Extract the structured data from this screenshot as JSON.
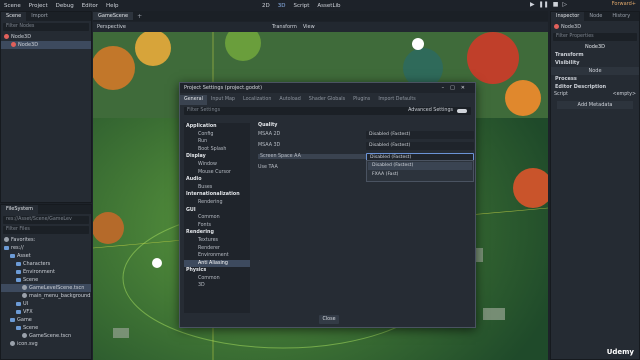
{
  "menu": [
    "Scene",
    "Project",
    "Debug",
    "Editor",
    "Help"
  ],
  "workspaces": [
    {
      "label": "2D"
    },
    {
      "label": "3D"
    },
    {
      "label": "Script"
    },
    {
      "label": "AssetLib"
    }
  ],
  "renderer": "Forward+",
  "scene_panel": {
    "tabs": [
      "Scene",
      "Import"
    ],
    "filter_placeholder": "Filter Nodes",
    "nodes": [
      "Node3D",
      "Node3D"
    ]
  },
  "scene_tabs": [
    "GameScene"
  ],
  "viewport": {
    "label": "Perspective",
    "menus": [
      "Transform",
      "View"
    ]
  },
  "filesystem": {
    "tab": "FileSystem",
    "path": "res://Asset/Scene/GameLev",
    "filter_placeholder": "Filter Files",
    "items": [
      {
        "label": "Favorites:",
        "indent": 0,
        "folder": false
      },
      {
        "label": "res://",
        "indent": 0,
        "folder": true
      },
      {
        "label": "Asset",
        "indent": 1,
        "folder": true
      },
      {
        "label": "Characters",
        "indent": 2,
        "folder": true
      },
      {
        "label": "Environment",
        "indent": 2,
        "folder": true
      },
      {
        "label": "Scene",
        "indent": 2,
        "folder": true
      },
      {
        "label": "GameLevelScene.tscn",
        "indent": 3,
        "folder": false,
        "selected": true
      },
      {
        "label": "main_menu_background.tscn",
        "indent": 3,
        "folder": false
      },
      {
        "label": "UI",
        "indent": 2,
        "folder": true
      },
      {
        "label": "VFX",
        "indent": 2,
        "folder": true
      },
      {
        "label": "Game",
        "indent": 1,
        "folder": true
      },
      {
        "label": "Scene",
        "indent": 2,
        "folder": true
      },
      {
        "label": "GameScene.tscn",
        "indent": 3,
        "folder": false
      },
      {
        "label": "icon.svg",
        "indent": 1,
        "folder": false
      }
    ]
  },
  "inspector": {
    "tabs": [
      "Inspector",
      "Node",
      "History"
    ],
    "node_name": "Node3D",
    "filter_placeholder": "Filter Properties",
    "sections": [
      "Transform",
      "Visibility"
    ],
    "class_label": "Node",
    "sections2": [
      "Process",
      "Editor Description"
    ],
    "script_label": "Script",
    "script_value": "<empty>",
    "add_metadata": "Add Metadata"
  },
  "dialog": {
    "title": "Project Settings (project.godot)",
    "tabs": [
      "General",
      "Input Map",
      "Localization",
      "Autoload",
      "Shader Globals",
      "Plugins",
      "Import Defaults"
    ],
    "filter_placeholder": "Filter Settings",
    "advanced_label": "Advanced Settings",
    "categories": [
      {
        "label": "Application",
        "children": [
          "Config",
          "Run",
          "Boot Splash"
        ]
      },
      {
        "label": "Display",
        "children": [
          "Window",
          "Mouse Cursor"
        ]
      },
      {
        "label": "Audio",
        "children": [
          "Buses"
        ]
      },
      {
        "label": "Internationalization",
        "children": [
          "Rendering"
        ]
      },
      {
        "label": "GUI",
        "children": [
          "Common",
          "Fonts"
        ]
      },
      {
        "label": "Rendering",
        "children": [
          "Textures",
          "Renderer",
          "Environment",
          "Anti Aliasing"
        ]
      },
      {
        "label": "Physics",
        "children": [
          "Common",
          "3D"
        ]
      }
    ],
    "selected_sub": "Anti Aliasing",
    "section_title": "Quality",
    "properties": [
      {
        "label": "MSAA 2D",
        "value": "Disabled (Fastest)"
      },
      {
        "label": "MSAA 3D",
        "value": "Disabled (Fastest)"
      },
      {
        "label": "Screen Space AA",
        "value": "Disabled (Fastest)"
      },
      {
        "label": "Use TAA",
        "value": ""
      }
    ],
    "dropdown_options": [
      "Disabled (Fastest)",
      "FXAA (Fast)"
    ],
    "close_label": "Close"
  },
  "watermark": "Udemy"
}
